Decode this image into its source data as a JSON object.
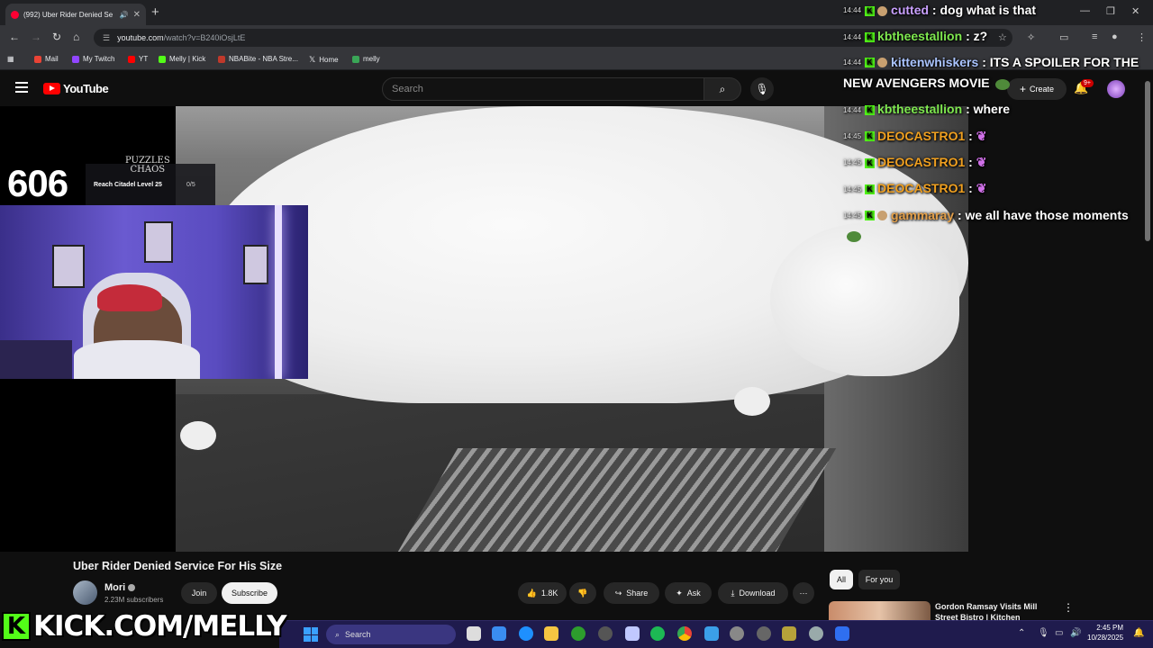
{
  "browser": {
    "tab_title": "(992) Uber Rider Denied Se",
    "url_host": "youtube.com",
    "url_path": "/watch?v=B240iOsjLtE",
    "bookmarks": [
      "Mail",
      "My Twitch",
      "YT",
      "Melly | Kick",
      "NBABite - NBA Stre...",
      "Home",
      "melly"
    ]
  },
  "youtube": {
    "logo_text": "YouTube",
    "search_placeholder": "Search",
    "create_label": "Create",
    "notification_count": "9+"
  },
  "overlay": {
    "score": "606",
    "puzzle_logo_line1": "PUZZLES",
    "puzzle_logo_line2": "CHAOS",
    "puzzle_goal": "Reach Citadel Level 25",
    "puzzle_progress": "0/5",
    "kick_banner": "KICK.COM/MELLY"
  },
  "video": {
    "title": "Uber Rider Denied Service For His Size",
    "channel": "Mori",
    "subscribers": "2.23M subscribers",
    "join_label": "Join",
    "subscribe_label": "Subscribe",
    "likes": "1.8K",
    "share_label": "Share",
    "ask_label": "Ask",
    "download_label": "Download"
  },
  "recommendations": {
    "chips": [
      "All",
      "For you"
    ],
    "first_title": "Gordon Ramsay Visits Mill Street Bistro | Kitchen"
  },
  "chat": [
    {
      "time": "14:44",
      "user": "cutted",
      "user_color": "#c9a0ff",
      "text": ": dog what is that"
    },
    {
      "time": "14:44",
      "user": "kbtheestallion",
      "user_color": "#7ee84f",
      "text": ": z?"
    },
    {
      "time": "14:44",
      "user": "kittenwhiskers",
      "user_color": "#aac4ff",
      "text": ": ITS A SPOILER FOR THE NEW AVENGERS MOVIE"
    },
    {
      "time": "14:44",
      "user": "kbtheestallion",
      "user_color": "#7ee84f",
      "text": ": where"
    },
    {
      "time": "14:45",
      "user": "DEOCASTRO1",
      "user_color": "#f0a020",
      "text": ":"
    },
    {
      "time": "14:45",
      "user": "DEOCASTRO1",
      "user_color": "#f0a020",
      "text": ":"
    },
    {
      "time": "14:45",
      "user": "DEOCASTRO1",
      "user_color": "#f0a020",
      "text": ":"
    },
    {
      "time": "14:45",
      "user": "gammaray",
      "user_color": "#e4a04a",
      "text": ": we all have those moments"
    }
  ],
  "taskbar": {
    "search_label": "Search",
    "time": "2:45 PM",
    "date": "10/28/2025"
  }
}
